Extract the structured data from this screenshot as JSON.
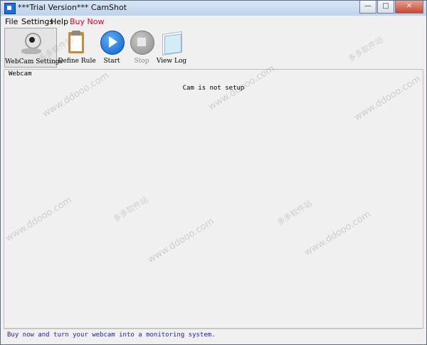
{
  "window": {
    "title": "***Trial Version*** CamShot",
    "controls": {
      "minimize": "—",
      "maximize": "□",
      "close": "✕"
    }
  },
  "menu": {
    "file": "File",
    "settings": "Settings",
    "help": "Help",
    "buy_now": "Buy Now"
  },
  "toolbar": {
    "webcam_settings": "WebCam Settings",
    "define_rule": "Define Rule",
    "start": "Start",
    "stop": "Stop",
    "view_log": "View Log"
  },
  "main": {
    "group_label": "Webcam",
    "cam_status": "Cam is not setup"
  },
  "status_bar": {
    "message": "Buy now and turn your webcam into a monitoring system."
  },
  "watermark": {
    "url": "www.ddooo.com",
    "cn": "多多软件站"
  },
  "colors": {
    "buy_now": "#e0002a",
    "status_text": "#2020c0",
    "start_button": "#0b5ec4"
  }
}
